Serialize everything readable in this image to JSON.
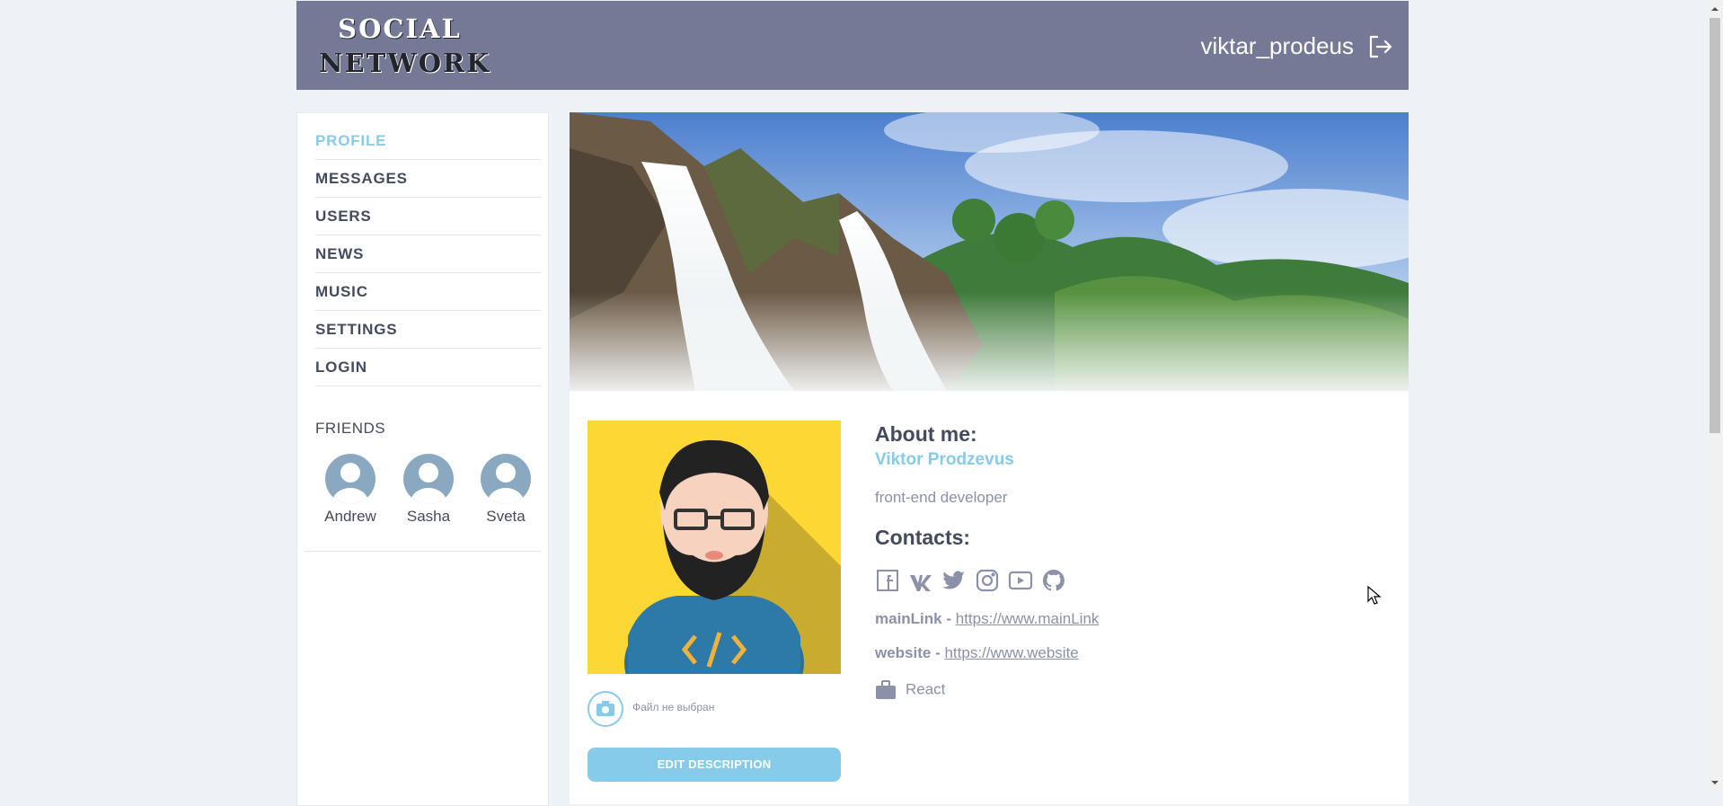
{
  "header": {
    "logo_line1": "SOCIAL",
    "logo_line2": "NETWORK",
    "username": "viktar_prodeus",
    "logout_icon": "logout-icon"
  },
  "sidebar": {
    "items": [
      {
        "label": "PROFILE",
        "active": true
      },
      {
        "label": "MESSAGES"
      },
      {
        "label": "USERS"
      },
      {
        "label": "NEWS"
      },
      {
        "label": "MUSIC"
      },
      {
        "label": "SETTINGS"
      },
      {
        "label": "LOGIN"
      }
    ],
    "friends_title": "FRIENDS",
    "friends": [
      {
        "name": "Andrew"
      },
      {
        "name": "Sasha"
      },
      {
        "name": "Sveta"
      }
    ]
  },
  "profile": {
    "file_label": "Файл не выбран",
    "edit_button": "EDIT DESCRIPTION",
    "about_title": "About me:",
    "full_name": "Viktor Prodzevus",
    "job": "front-end developer",
    "contacts_title": "Contacts:",
    "social_icons": [
      "facebook-icon",
      "vk-icon",
      "twitter-icon",
      "instagram-icon",
      "youtube-icon",
      "github-icon"
    ],
    "links": [
      {
        "label": "mainLink",
        "sep": " - ",
        "url": "https://www.mainLink"
      },
      {
        "label": "website",
        "sep": " - ",
        "url": "https://www.website"
      }
    ],
    "skill": "React"
  },
  "colors": {
    "header_bg": "#747a95",
    "accent": "#86cbe9",
    "page_bg": "#eef2f6",
    "text_dark": "#454b5e",
    "text_muted": "#8a91a8"
  }
}
